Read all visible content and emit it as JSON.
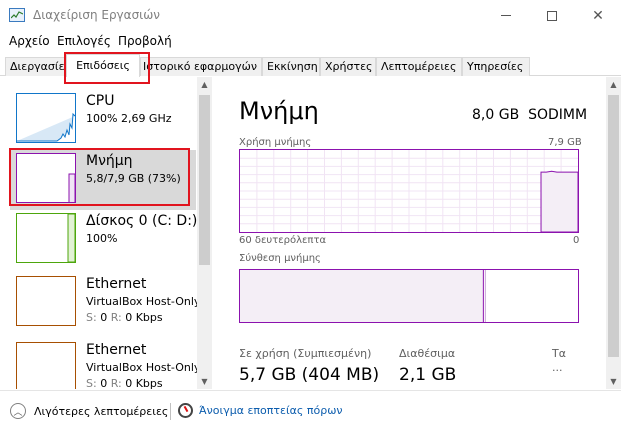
{
  "window": {
    "title": "Διαχείριση Εργασιών",
    "icon": "task-manager-icon"
  },
  "menu": {
    "items": [
      "Αρχείο",
      "Επιλογές",
      "Προβολή"
    ]
  },
  "tabs": [
    {
      "label": "Διεργασίες",
      "active": false
    },
    {
      "label": "Επιδόσεις",
      "active": true
    },
    {
      "label": "Ιστορικό εφαρμογών",
      "active": false
    },
    {
      "label": "Εκκίνηση",
      "active": false
    },
    {
      "label": "Χρήστες",
      "active": false
    },
    {
      "label": "Λεπτομέρειες",
      "active": false
    },
    {
      "label": "Υπηρεσίες",
      "active": false
    }
  ],
  "resources": [
    {
      "name": "CPU",
      "detail": "100% 2,69 GHz",
      "color": "#1176c9"
    },
    {
      "name": "Μνήμη",
      "detail": "5,8/7,9 GB (73%)",
      "color": "#8b12ae",
      "selected": true
    },
    {
      "name": "Δίσκος 0 (C: D:)",
      "detail": "100%",
      "color": "#4da60c"
    },
    {
      "name": "Ethernet",
      "detail": "VirtualBox Host-Only",
      "send_label": "S:",
      "send": "0",
      "recv_label": "R:",
      "recv": "0 Kbps",
      "color": "#a74f01"
    },
    {
      "name": "Ethernet",
      "detail": "VirtualBox Host-Only",
      "send_label": "S:",
      "send": "0",
      "recv_label": "R:",
      "recv": "0 Kbps",
      "color": "#a74f01"
    }
  ],
  "memory": {
    "title": "Μνήμη",
    "total": "8,0 GB",
    "type": "SODIMM",
    "usage_label": "Χρήση μνήμης",
    "usage_max": "7,9 GB",
    "time_label": "60 δευτερόλεπτα",
    "time_zero": "0",
    "composition_label": "Σύνθεση μνήμης",
    "composition_in_use": 0.72,
    "usage_history": [
      0,
      0,
      0,
      0,
      0,
      0,
      0,
      0,
      0,
      0,
      0,
      0,
      0,
      0,
      0,
      0,
      0,
      0,
      0,
      0,
      0,
      0,
      0,
      0,
      0,
      0,
      0,
      0,
      0,
      0,
      0,
      0,
      0,
      0,
      0,
      0,
      0,
      0,
      0,
      0,
      0,
      0,
      0,
      0,
      0,
      0,
      0,
      0,
      0,
      0,
      0,
      0,
      0,
      0,
      0,
      0,
      0,
      0.73,
      0.73,
      0.74,
      0.73,
      0.73,
      0.73,
      0.73,
      0.73
    ],
    "in_use_label": "Σε χρήση (Συμπιεσμένη)",
    "in_use_value": "5,7 GB (404 MB)",
    "available_label": "Διαθέσιμα",
    "available_value": "2,1 GB",
    "speed_label_partial": "Τα"
  },
  "bottom": {
    "less_details": "Λιγότερες λεπτομέρειες",
    "resource_monitor": "Άνοιγμα εποπτείας πόρων"
  },
  "colors": {
    "memory_accent": "#8b12ae",
    "highlight": "#e1141e",
    "link": "#0b5cad"
  }
}
